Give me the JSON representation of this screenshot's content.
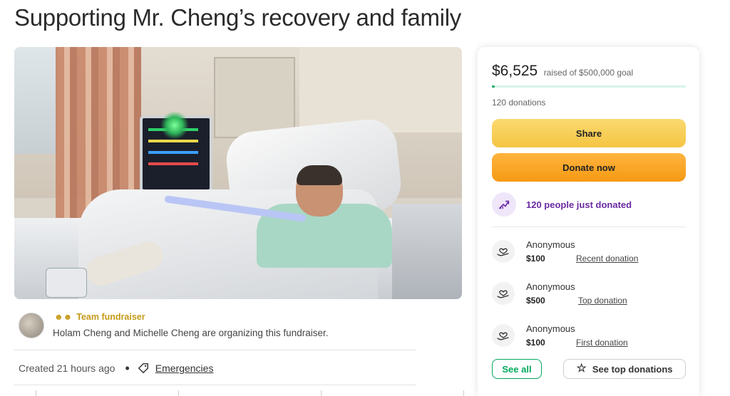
{
  "page": {
    "title": "Supporting Mr. Cheng’s recovery and family"
  },
  "organizer": {
    "badge": "Team fundraiser",
    "text": "Holam Cheng and Michelle Cheng are organizing this fundraiser."
  },
  "meta": {
    "created": "Created 21 hours ago",
    "category": "Emergencies"
  },
  "donation_card": {
    "raised": "$6,525",
    "goal": "raised of $500,000 goal",
    "progress_percent": 1.3,
    "donations_count": "120 donations",
    "share_label": "Share",
    "donate_label": "Donate now",
    "recent_activity": "120 people just donated",
    "donors": [
      {
        "name": "Anonymous",
        "amount": "$100",
        "type": "Recent donation"
      },
      {
        "name": "Anonymous",
        "amount": "$500",
        "type": "Top donation"
      },
      {
        "name": "Anonymous",
        "amount": "$100",
        "type": "First donation"
      }
    ],
    "see_all_label": "See all",
    "see_top_label": "See top donations"
  },
  "colors": {
    "accent_green": "#02a95c",
    "share_yellow": "#f4c542",
    "donate_orange": "#f59a13",
    "purple": "#6a2aa3",
    "badge_gold": "#c59a18"
  }
}
